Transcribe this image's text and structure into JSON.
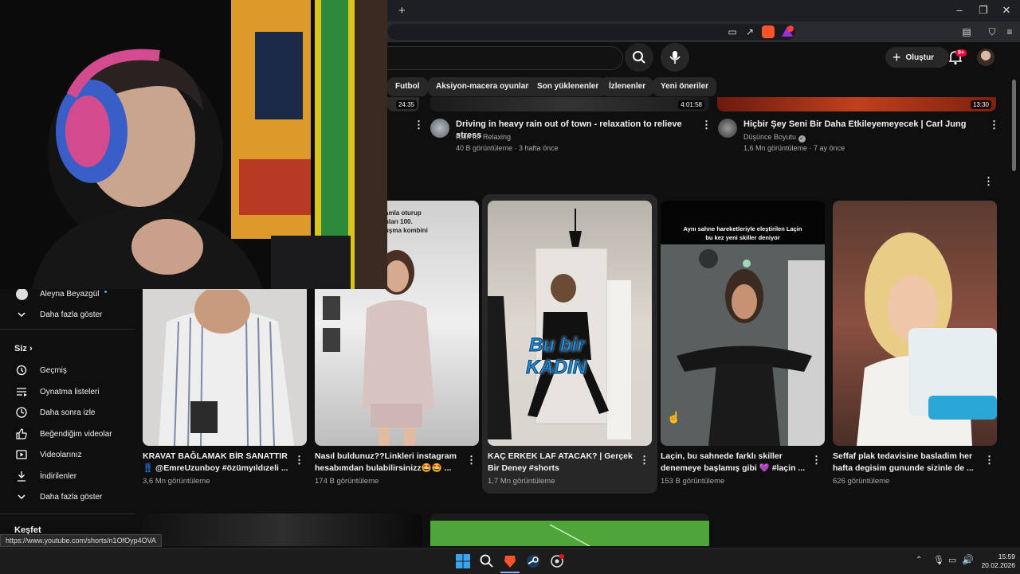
{
  "browser": {
    "new_tab_symbol": "+",
    "status_url": "https://www.youtube.com/shorts/n1OfOyp4OVA"
  },
  "header": {
    "create_label": "Oluştur",
    "notif_badge": "9+"
  },
  "chips": [
    "Futbol",
    "Aksiyon-macera oyunları",
    "Son yüklenenler",
    "İzlenenler",
    "Yeni öneriler"
  ],
  "top_videos": [
    {
      "duration": "24:35"
    },
    {
      "duration": "4:01:58",
      "title": "Driving in heavy rain out of town - relaxation to relieve stress",
      "channel": "Rain for Relaxing",
      "stats": "40 B görüntüleme · 3 hafta önce"
    },
    {
      "duration": "13:30",
      "title": "Hiçbir Şey Seni Bir Daha Etkileyemeyecek | Carl Jung",
      "channel": "Düşünce Boyutu",
      "stats": "1,6 Mn görüntüleme · 7 ay önce"
    }
  ],
  "shorts": [
    {
      "title": "KRAVAT BAĞLAMAK BİR SANATTIR 👖 @EmreUzunboy #özümyıldızeli ...",
      "views": "3,6 Mn görüntüleme"
    },
    {
      "title": "Nasıl buldunuz??Linkleri instagram hesabımdan bulabilirsinizz🤩🤩 ...",
      "views": "174 B görüntüleme",
      "overlay": "amla oturup\nuları 100.\nuşma kombini"
    },
    {
      "title": "KAÇ ERKEK LAF ATACAK? | Gerçek Bir Deney #shorts",
      "views": "1,7 Mn görüntüleme",
      "overlay1": "Bu bir",
      "overlay2": "KADIN"
    },
    {
      "title": "Laçin, bu sahnede farklı skiller denemeye başlamış gibi 💜 #laçin ...",
      "views": "153 B görüntüleme",
      "overlay": "Aynı sahne hareketleriyle eleştirilen Laçin\nbu kez yeni skiller deniyor"
    },
    {
      "title": "Seffaf plak tedavisine basladim her hafta degisim gununde sizinle de ...",
      "views": "626 görüntüleme"
    }
  ],
  "sidebar": {
    "sub_name": "Aleyna Beyazgül",
    "show_more_1": "Daha fazla göster",
    "you_label": "Siz",
    "items": [
      "Geçmiş",
      "Oynatma listeleri",
      "Daha sonra izle",
      "Beğendiğim videolar",
      "Videolarınız",
      "İndirilenler",
      "Daha fazla göster"
    ],
    "explore": "Keşfet"
  },
  "taskbar": {
    "time": "15:59",
    "date": "20.02.2026"
  },
  "colors": {
    "accent_red": "#ff0033",
    "brave_orange": "#fb542b"
  }
}
